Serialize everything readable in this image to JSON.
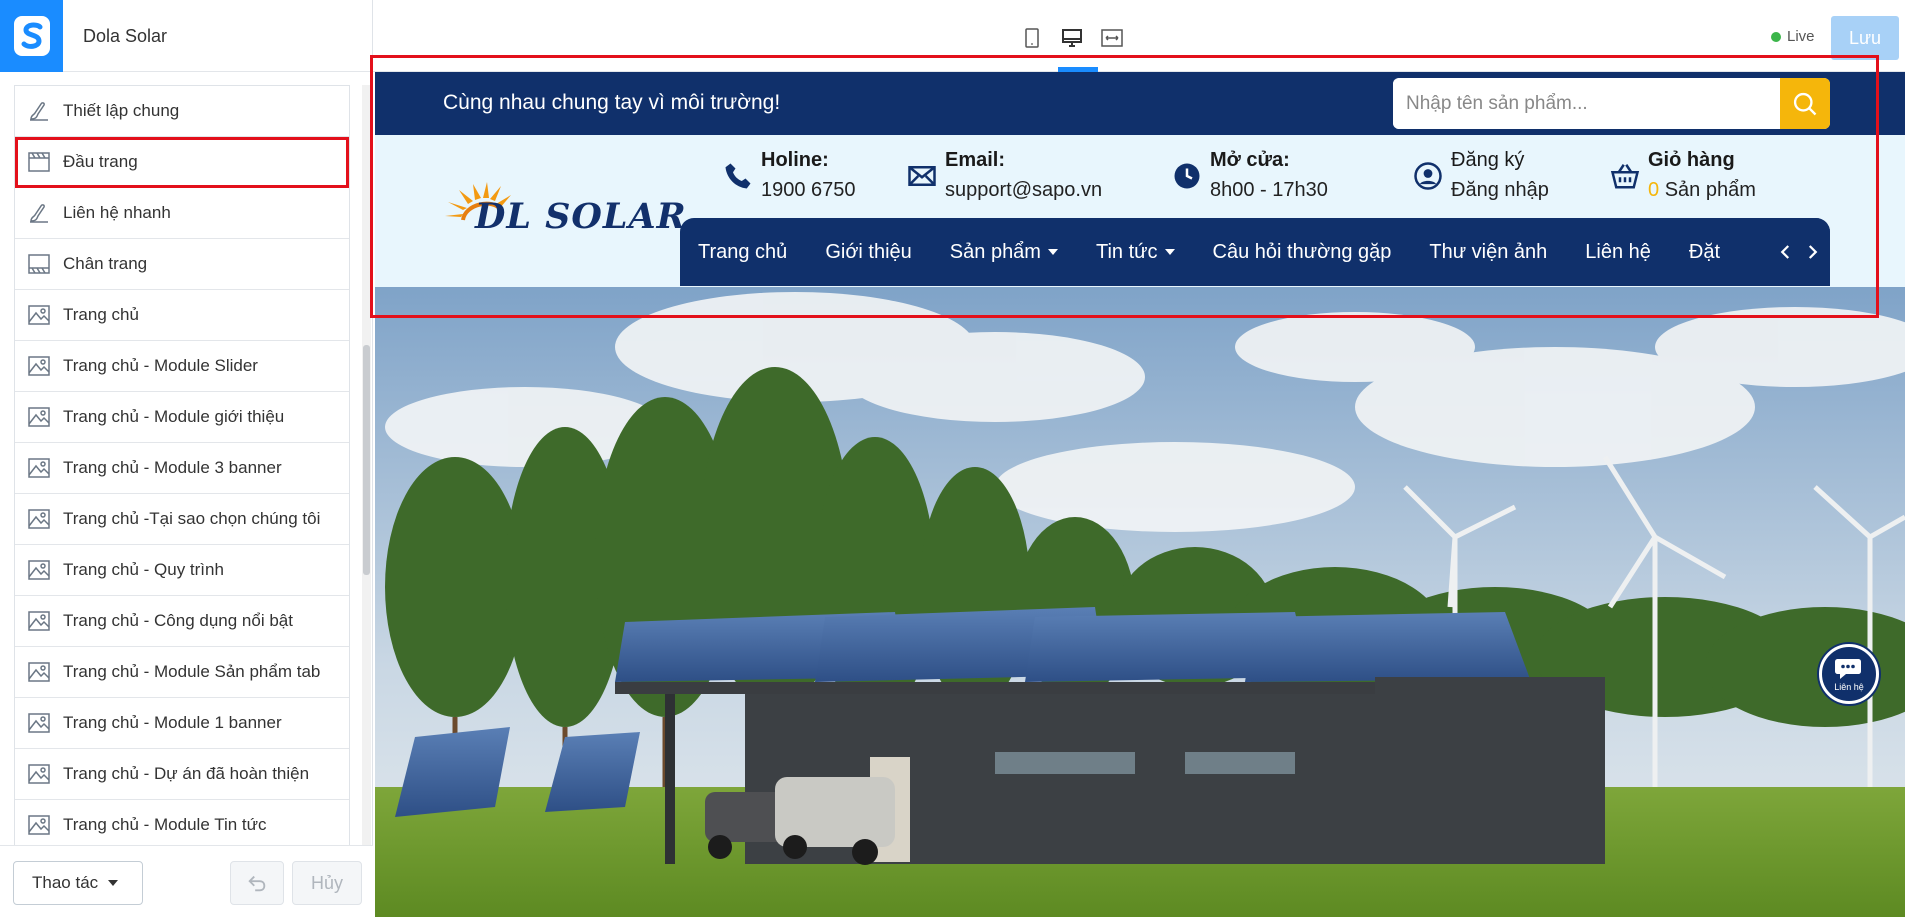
{
  "app": {
    "title": "Dola Solar",
    "logo_icon": "sapo-s-logo"
  },
  "sidebar": {
    "items": [
      {
        "label": "Thiết lập chung",
        "icon": "brush-icon"
      },
      {
        "label": "Đầu trang",
        "icon": "header-icon",
        "active": true
      },
      {
        "label": "Liên hệ nhanh",
        "icon": "brush-icon"
      },
      {
        "label": "Chân trang",
        "icon": "footer-icon"
      },
      {
        "label": "Trang chủ",
        "icon": "image-icon"
      },
      {
        "label": "Trang chủ - Module Slider",
        "icon": "image-icon"
      },
      {
        "label": "Trang chủ - Module giới thiệu",
        "icon": "image-icon"
      },
      {
        "label": "Trang chủ - Module 3 banner",
        "icon": "image-icon"
      },
      {
        "label": "Trang chủ -Tại sao chọn chúng tôi",
        "icon": "image-icon"
      },
      {
        "label": "Trang chủ - Quy trình",
        "icon": "image-icon"
      },
      {
        "label": "Trang chủ - Công dụng nổi bật",
        "icon": "image-icon"
      },
      {
        "label": "Trang chủ - Module Sản phẩm tab",
        "icon": "image-icon"
      },
      {
        "label": "Trang chủ - Module 1 banner",
        "icon": "image-icon"
      },
      {
        "label": "Trang chủ - Dự án đã hoàn thiện",
        "icon": "image-icon"
      },
      {
        "label": "Trang chủ - Module Tin tức",
        "icon": "image-icon"
      }
    ],
    "footer": {
      "actions_label": "Thao tác",
      "cancel_label": "Hủy"
    }
  },
  "toolbar": {
    "devices": [
      "mobile-icon",
      "desktop-icon",
      "fullwidth-icon"
    ],
    "selected_device": "desktop",
    "live_label": "Live",
    "save_label": "Lưu"
  },
  "preview": {
    "slogan": "Cùng nhau chung tay vì môi trường!",
    "search_placeholder": "Nhập tên sản phẩm...",
    "brand": "DL SOLAR",
    "info": {
      "hotline_title": "Holine:",
      "hotline_value": "1900 6750",
      "email_title": "Email:",
      "email_value": "support@sapo.vn",
      "open_title": "Mở cửa:",
      "open_value": "8h00 - 17h30",
      "register": "Đăng ký",
      "login": "Đăng nhập",
      "cart_title": "Giỏ hàng",
      "cart_count": "0",
      "cart_unit": "Sản phẩm"
    },
    "menu": [
      "Trang chủ",
      "Giới thiệu",
      "Sản phẩm",
      "Tin tức",
      "Câu hỏi thường gặp",
      "Thư viện ảnh",
      "Liên hệ",
      "Đặt"
    ],
    "contact_fab_label": "Liên hệ"
  },
  "colors": {
    "navy": "#10306b",
    "accent": "#f5b60b",
    "highlight": "#e3101b",
    "primary": "#1a8cff"
  }
}
